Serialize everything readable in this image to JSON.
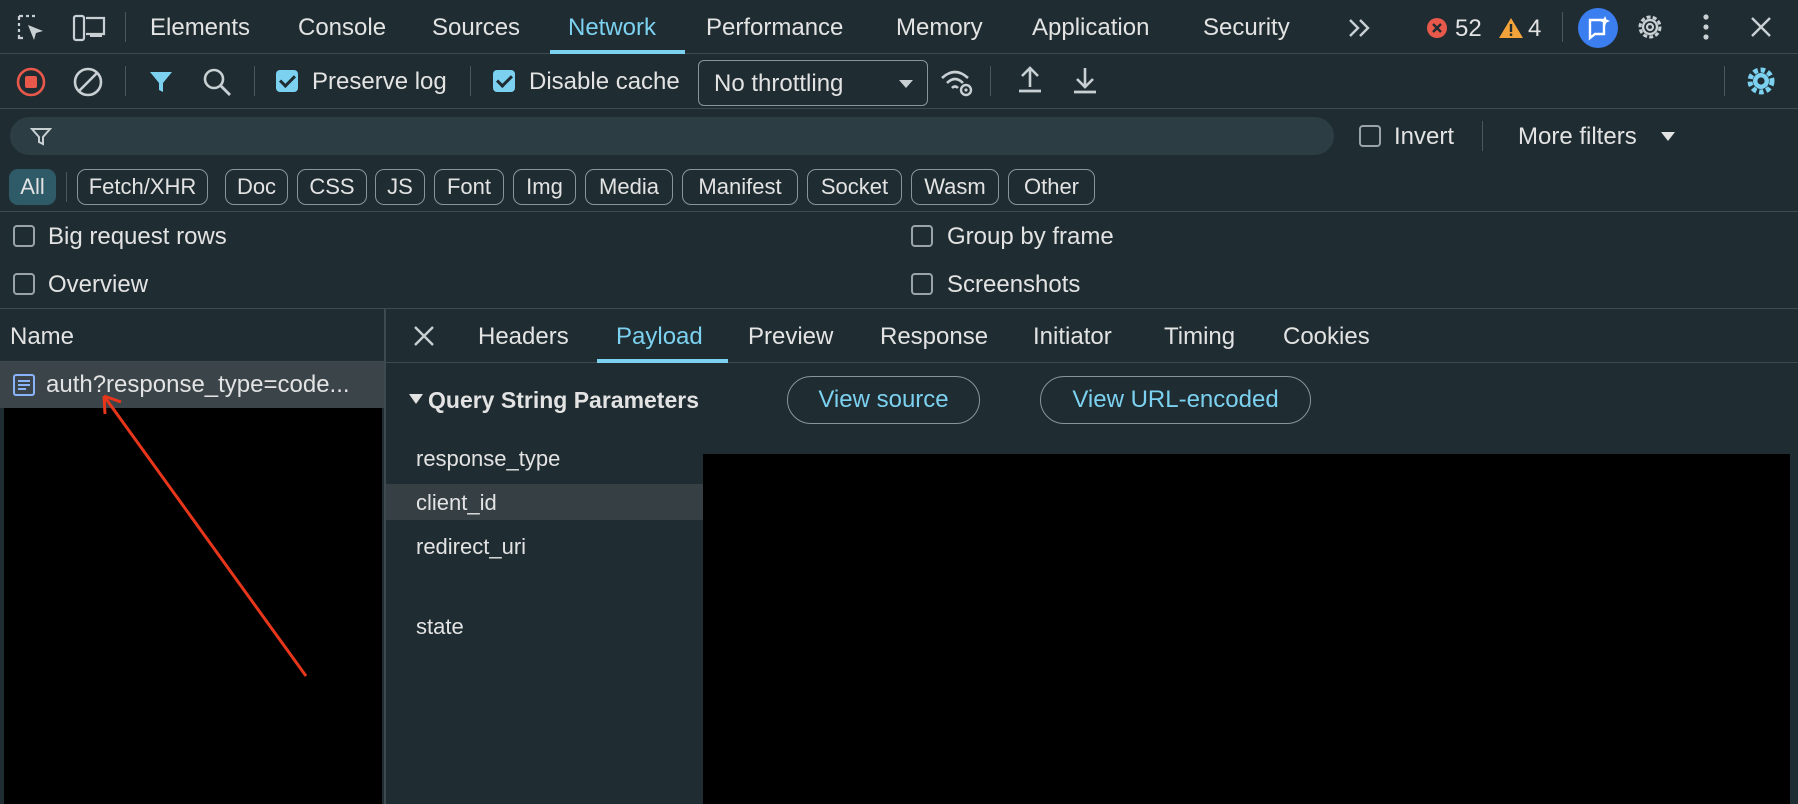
{
  "top_tabs": [
    "Elements",
    "Console",
    "Sources",
    "Network",
    "Performance",
    "Memory",
    "Application",
    "Security"
  ],
  "active_top_tab": "Network",
  "badges": {
    "errors": "52",
    "warnings": "4"
  },
  "colors": {
    "accent": "#7cd1f0",
    "error": "#e8584b",
    "warning": "#f2a33a",
    "record": "#e8584b",
    "ai_button": "#3b7ef0",
    "arrow": "#e8361b"
  },
  "toolbar": {
    "preserve_log_label": "Preserve log",
    "preserve_log_checked": true,
    "disable_cache_label": "Disable cache",
    "disable_cache_checked": true,
    "throttling_value": "No throttling"
  },
  "filter": {
    "placeholder": "",
    "invert_label": "Invert",
    "more_filters_label": "More filters"
  },
  "type_filters": [
    "All",
    "Fetch/XHR",
    "Doc",
    "CSS",
    "JS",
    "Font",
    "Img",
    "Media",
    "Manifest",
    "Socket",
    "Wasm",
    "Other"
  ],
  "active_type_filter": "All",
  "options": {
    "big_request_rows": "Big request rows",
    "overview": "Overview",
    "group_by_frame": "Group by frame",
    "screenshots": "Screenshots"
  },
  "request_list": {
    "name_header": "Name",
    "rows": [
      "auth?response_type=code..."
    ]
  },
  "detail_tabs": [
    "Headers",
    "Payload",
    "Preview",
    "Response",
    "Initiator",
    "Timing",
    "Cookies"
  ],
  "active_detail_tab": "Payload",
  "payload": {
    "section_title": "Query String Parameters",
    "view_source_label": "View source",
    "view_url_encoded_label": "View URL-encoded",
    "params": [
      "response_type",
      "client_id",
      "redirect_uri",
      "state"
    ]
  }
}
